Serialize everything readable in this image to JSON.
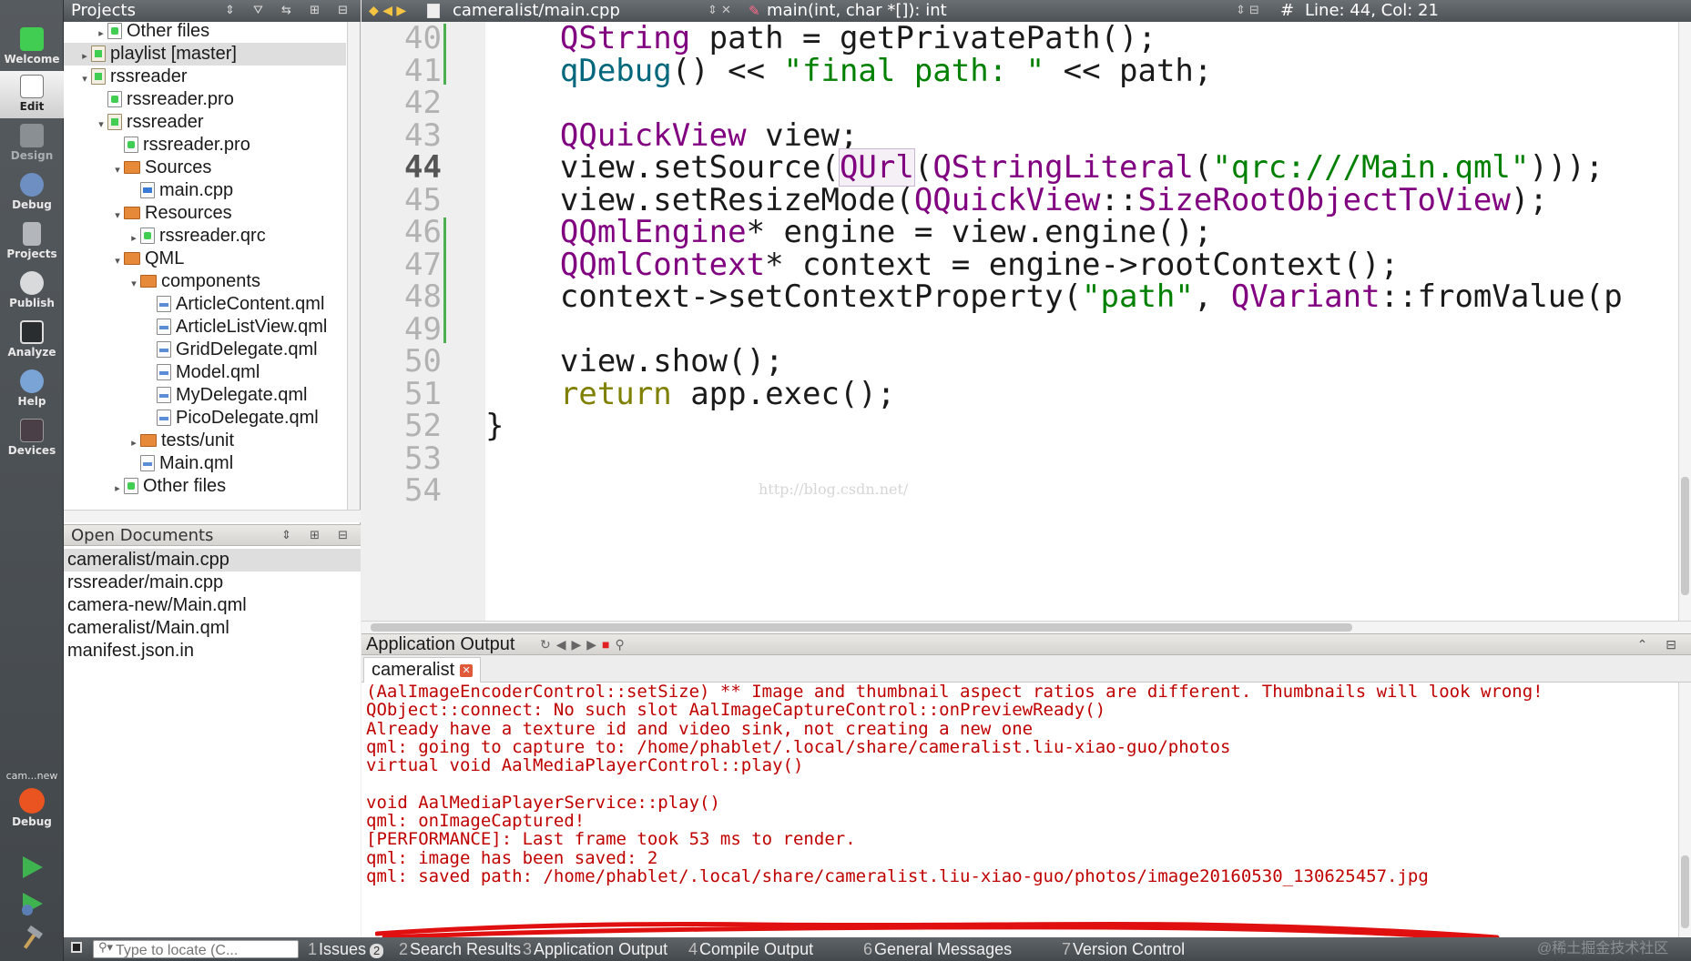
{
  "modes": [
    {
      "label": "Welcome",
      "icon": "qt-welcome-icon",
      "active": false
    },
    {
      "label": "Edit",
      "icon": "edit-document-icon",
      "active": true
    },
    {
      "label": "Design",
      "icon": "design-pencil-icon",
      "active": false
    },
    {
      "label": "Debug",
      "icon": "debug-bug-icon",
      "active": false
    },
    {
      "label": "Projects",
      "icon": "projects-wrench-icon",
      "active": false
    },
    {
      "label": "Publish",
      "icon": "publish-icon",
      "active": false
    },
    {
      "label": "Analyze",
      "icon": "analyze-monitor-icon",
      "active": false
    },
    {
      "label": "Help",
      "icon": "help-question-icon",
      "active": false
    },
    {
      "label": "Devices",
      "icon": "devices-phone-icon",
      "active": false
    }
  ],
  "kit": {
    "project_name": "cam...new",
    "build_mode": "Debug"
  },
  "projects_pane": {
    "title": "Projects",
    "tree": [
      {
        "label": "Other files",
        "depth": 1,
        "arrow": "▸",
        "icon": "qt"
      },
      {
        "label": "playlist [master]",
        "depth": 0,
        "arrow": "▸",
        "icon": "prj",
        "selected": true
      },
      {
        "label": "rssreader",
        "depth": 0,
        "arrow": "▾",
        "icon": "prj"
      },
      {
        "label": "rssreader.pro",
        "depth": 1,
        "arrow": "",
        "icon": "qt"
      },
      {
        "label": "rssreader",
        "depth": 1,
        "arrow": "▾",
        "icon": "prj"
      },
      {
        "label": "rssreader.pro",
        "depth": 2,
        "arrow": "",
        "icon": "qt"
      },
      {
        "label": "Sources",
        "depth": 2,
        "arrow": "▾",
        "icon": "folder"
      },
      {
        "label": "main.cpp",
        "depth": 3,
        "arrow": "",
        "icon": "cpp"
      },
      {
        "label": "Resources",
        "depth": 2,
        "arrow": "▾",
        "icon": "folder"
      },
      {
        "label": "rssreader.qrc",
        "depth": 3,
        "arrow": "▸",
        "icon": "qt"
      },
      {
        "label": "QML",
        "depth": 2,
        "arrow": "▾",
        "icon": "folder"
      },
      {
        "label": "components",
        "depth": 3,
        "arrow": "▾",
        "icon": "folder"
      },
      {
        "label": "ArticleContent.qml",
        "depth": 4,
        "arrow": "",
        "icon": "qml"
      },
      {
        "label": "ArticleListView.qml",
        "depth": 4,
        "arrow": "",
        "icon": "qml"
      },
      {
        "label": "GridDelegate.qml",
        "depth": 4,
        "arrow": "",
        "icon": "qml"
      },
      {
        "label": "Model.qml",
        "depth": 4,
        "arrow": "",
        "icon": "qml"
      },
      {
        "label": "MyDelegate.qml",
        "depth": 4,
        "arrow": "",
        "icon": "qml"
      },
      {
        "label": "PicoDelegate.qml",
        "depth": 4,
        "arrow": "",
        "icon": "qml"
      },
      {
        "label": "tests/unit",
        "depth": 3,
        "arrow": "▸",
        "icon": "folder"
      },
      {
        "label": "Main.qml",
        "depth": 3,
        "arrow": "",
        "icon": "qml"
      },
      {
        "label": "Other files",
        "depth": 2,
        "arrow": "▸",
        "icon": "qt"
      }
    ]
  },
  "open_documents": {
    "title": "Open Documents",
    "items": [
      "cameralist/main.cpp",
      "rssreader/main.cpp",
      "camera-new/Main.qml",
      "cameralist/Main.qml",
      "manifest.json.in"
    ],
    "selected_index": 0
  },
  "editor": {
    "file": "cameralist/main.cpp",
    "symbol": "main(int, char *[]): int",
    "position": "Line: 44, Col: 21",
    "current_line": 44,
    "watermark": "http://blog.csdn.net/",
    "lines": [
      {
        "n": "40",
        "code": [
          {
            "t": "    "
          },
          {
            "t": "QString",
            "c": "t"
          },
          {
            "t": " path = getPrivatePath();"
          }
        ]
      },
      {
        "n": "41",
        "code": [
          {
            "t": "    "
          },
          {
            "t": "qDebug",
            "c": "fn"
          },
          {
            "t": "() << "
          },
          {
            "t": "\"final path: \"",
            "c": "s"
          },
          {
            "t": " << path;"
          }
        ]
      },
      {
        "n": "42",
        "code": []
      },
      {
        "n": "43",
        "code": [
          {
            "t": "    "
          },
          {
            "t": "QQuickView",
            "c": "t"
          },
          {
            "t": " view;"
          }
        ]
      },
      {
        "n": "44",
        "code": [
          {
            "t": "    view.setSource("
          },
          {
            "t": "QUrl",
            "c": "t hl"
          },
          {
            "t": "("
          },
          {
            "t": "QStringLiteral",
            "c": "t"
          },
          {
            "t": "("
          },
          {
            "t": "\"qrc:///Main.qml\"",
            "c": "s"
          },
          {
            "t": ")));"
          }
        ]
      },
      {
        "n": "45",
        "code": [
          {
            "t": "    view.setResizeMode("
          },
          {
            "t": "QQuickView",
            "c": "t"
          },
          {
            "t": "::"
          },
          {
            "t": "SizeRootObjectToView",
            "c": "t"
          },
          {
            "t": ");"
          }
        ]
      },
      {
        "n": "46",
        "code": [
          {
            "t": "    "
          },
          {
            "t": "QQmlEngine",
            "c": "t"
          },
          {
            "t": "* engine = view.engine();"
          }
        ]
      },
      {
        "n": "47",
        "code": [
          {
            "t": "    "
          },
          {
            "t": "QQmlContext",
            "c": "t"
          },
          {
            "t": "* context = engine->rootContext();"
          }
        ]
      },
      {
        "n": "48",
        "code": [
          {
            "t": "    context->setContextProperty("
          },
          {
            "t": "\"path\"",
            "c": "s"
          },
          {
            "t": ", "
          },
          {
            "t": "QVariant",
            "c": "t"
          },
          {
            "t": "::fromValue(p"
          }
        ]
      },
      {
        "n": "49",
        "code": []
      },
      {
        "n": "50",
        "code": [
          {
            "t": "    view.show();"
          }
        ]
      },
      {
        "n": "51",
        "code": [
          {
            "t": "    "
          },
          {
            "t": "return",
            "c": "kw"
          },
          {
            "t": " app.exec();"
          }
        ]
      },
      {
        "n": "52",
        "code": [
          {
            "t": "}"
          }
        ]
      },
      {
        "n": "53",
        "code": []
      },
      {
        "n": "54",
        "code": []
      }
    ]
  },
  "output_pane": {
    "title": "Application Output",
    "tab": "cameralist",
    "lines": [
      "(AalImageEncoderControl::setSize) ** Image and thumbnail aspect ratios are different. Thumbnails will look wrong!",
      "QObject::connect: No such slot AalImageCaptureControl::onPreviewReady()",
      "Already have a texture id and video sink, not creating a new one",
      "qml: going to capture to: /home/phablet/.local/share/cameralist.liu-xiao-guo/photos",
      "virtual void AalMediaPlayerControl::play()",
      "",
      "void AalMediaPlayerService::play()",
      "qml: onImageCaptured!",
      "[PERFORMANCE]: Last frame took 53 ms to render.",
      "qml: image has been saved: 2",
      "qml: saved path: /home/phablet/.local/share/cameralist.liu-xiao-guo/photos/image20160530_130625457.jpg"
    ]
  },
  "statusbar": {
    "locator_placeholder": "Type to locate (C...",
    "tabs": [
      {
        "num": "1",
        "label": "Issues",
        "badge": "2"
      },
      {
        "num": "2",
        "label": "Search Results"
      },
      {
        "num": "3",
        "label": "Application Output"
      },
      {
        "num": "4",
        "label": "Compile Output"
      },
      {
        "num": "6",
        "label": "General Messages"
      },
      {
        "num": "7",
        "label": "Version Control"
      }
    ],
    "watermark": "@稀土掘金技术社区"
  }
}
